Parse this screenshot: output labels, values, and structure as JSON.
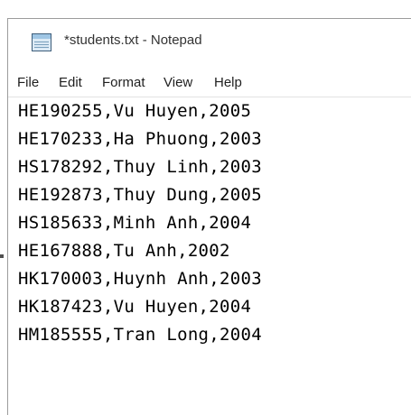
{
  "window": {
    "title": "*students.txt - Notepad",
    "icon": "notepad-icon"
  },
  "menubar": {
    "items": [
      "File",
      "Edit",
      "Format",
      "View",
      "Help"
    ]
  },
  "editor": {
    "lines": [
      "HE190255,Vu Huyen,2005",
      "HE170233,Ha Phuong,2003",
      "HS178292,Thuy Linh,2003",
      "HE192873,Thuy Dung,2005",
      "HS185633,Minh Anh,2004",
      "HE167888,Tu Anh,2002",
      "HK170003,Huynh Anh,2003",
      "HK187423,Vu Huyen,2004",
      "HM185555,Tran Long,2004"
    ]
  }
}
